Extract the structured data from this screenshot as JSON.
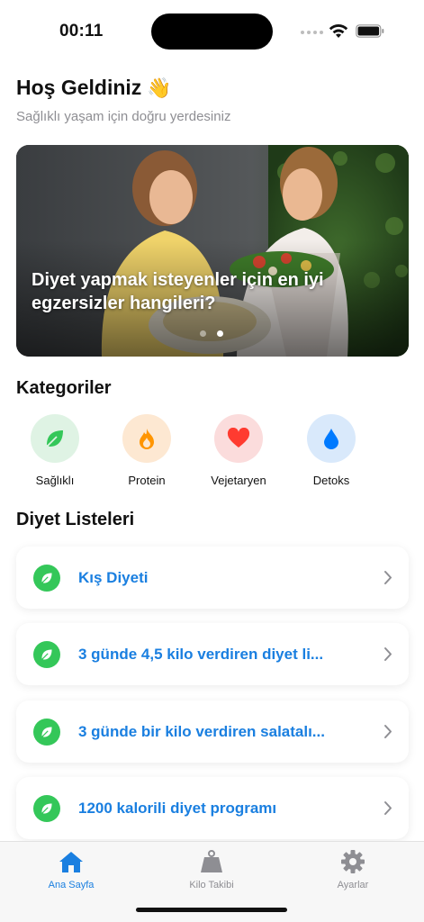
{
  "status_bar": {
    "time": "00:11"
  },
  "header": {
    "title": "Hoş Geldiniz",
    "emoji": "👋",
    "subtitle": "Sağlıklı yaşam için doğru yerdesiniz"
  },
  "hero": {
    "caption": "Diyet yapmak isteyenler için en iyi egzersizler hangileri?",
    "slide_count": 2,
    "active_slide": 2
  },
  "categories": {
    "title": "Kategoriler",
    "items": [
      {
        "label": "Sağlıklı",
        "icon": "leaf-icon",
        "bg": "#dff3e4",
        "color": "#34c759"
      },
      {
        "label": "Protein",
        "icon": "flame-icon",
        "bg": "#fde8d2",
        "color": "#ff9500"
      },
      {
        "label": "Vejetaryen",
        "icon": "heart-icon",
        "bg": "#fbdcdc",
        "color": "#ff3b30"
      },
      {
        "label": "Detoks",
        "icon": "drop-icon",
        "bg": "#d9e9fb",
        "color": "#007aff"
      }
    ]
  },
  "diet_lists": {
    "title": "Diyet Listeleri",
    "items": [
      {
        "label": "Kış Diyeti"
      },
      {
        "label": "3 günde 4,5 kilo verdiren diyet li..."
      },
      {
        "label": "3 günde bir kilo verdiren salatalı..."
      },
      {
        "label": "1200 kalorili diyet programı"
      }
    ]
  },
  "tabbar": {
    "items": [
      {
        "label": "Ana Sayfa",
        "icon": "house-icon",
        "active": true
      },
      {
        "label": "Kilo Takibi",
        "icon": "scale-icon",
        "active": false
      },
      {
        "label": "Ayarlar",
        "icon": "gear-icon",
        "active": false
      }
    ]
  },
  "colors": {
    "accent": "#1a7fe0",
    "green": "#34c759"
  }
}
